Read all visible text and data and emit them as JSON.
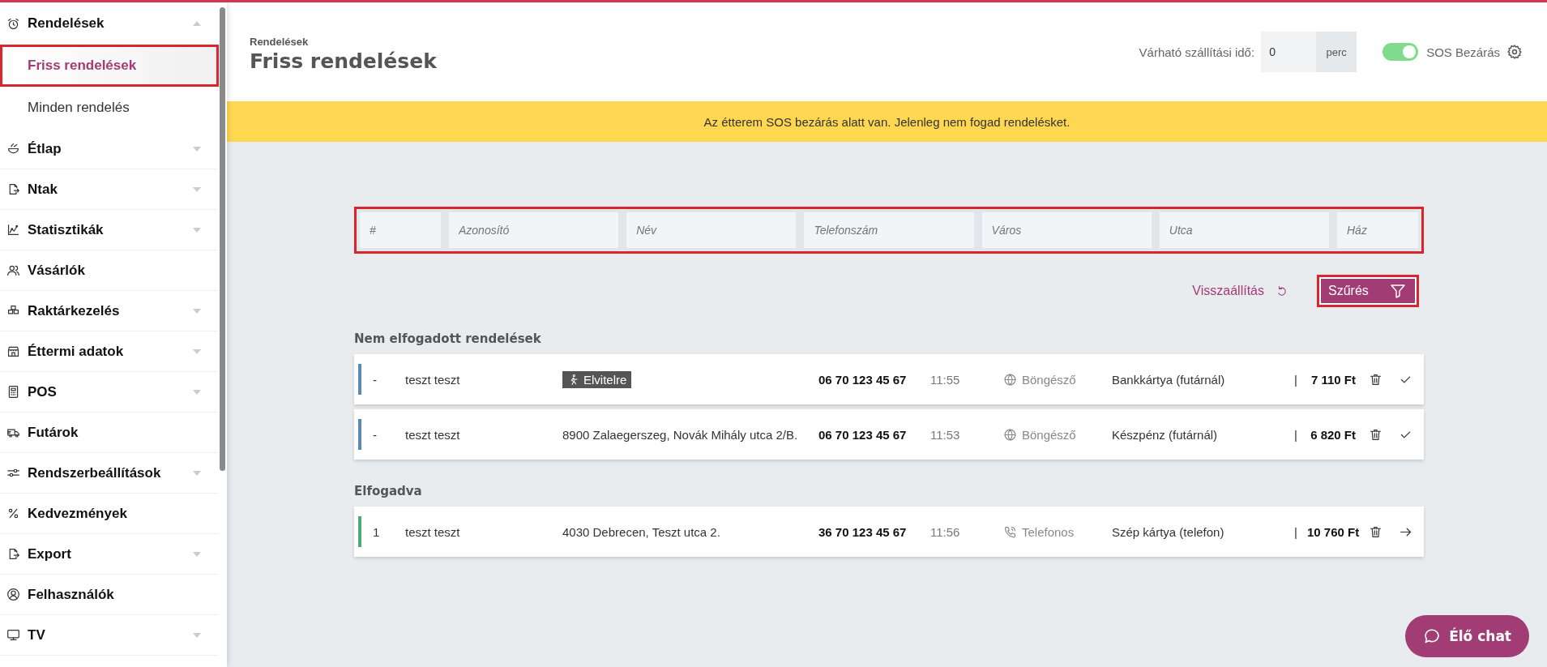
{
  "sidebar": {
    "items": [
      {
        "label": "Rendelések",
        "expandable": true,
        "expanded": true,
        "children": [
          {
            "label": "Friss rendelések",
            "selected": true,
            "highlighted": true
          },
          {
            "label": "Minden rendelés",
            "selected": false,
            "highlighted": false
          }
        ]
      },
      {
        "label": "Étlap",
        "expandable": true,
        "expanded": false
      },
      {
        "label": "Ntak",
        "expandable": true,
        "expanded": false
      },
      {
        "label": "Statisztikák",
        "expandable": true,
        "expanded": false
      },
      {
        "label": "Vásárlók",
        "expandable": false,
        "expanded": false
      },
      {
        "label": "Raktárkezelés",
        "expandable": true,
        "expanded": false
      },
      {
        "label": "Éttermi adatok",
        "expandable": true,
        "expanded": false
      },
      {
        "label": "POS",
        "expandable": true,
        "expanded": false
      },
      {
        "label": "Futárok",
        "expandable": false,
        "expanded": false
      },
      {
        "label": "Rendszerbeállítások",
        "expandable": true,
        "expanded": false
      },
      {
        "label": "Kedvezmények",
        "expandable": false,
        "expanded": false
      },
      {
        "label": "Export",
        "expandable": true,
        "expanded": false
      },
      {
        "label": "Felhasználók",
        "expandable": false,
        "expanded": false
      },
      {
        "label": "TV",
        "expandable": true,
        "expanded": false
      }
    ]
  },
  "header": {
    "breadcrumb": "Rendelések",
    "title": "Friss rendelések",
    "delivery_time": {
      "label": "Várható szállítási idő:",
      "value": "0",
      "unit": "perc"
    },
    "sos_toggle": {
      "label": "SOS Bezárás",
      "on": true
    }
  },
  "banner": "Az étterem SOS bezárás alatt van. Jelenleg nem fogad rendelésket.",
  "filter": {
    "highlighted": true,
    "fields": [
      {
        "placeholder": "#"
      },
      {
        "placeholder": "Azonosító"
      },
      {
        "placeholder": "Név"
      },
      {
        "placeholder": "Telefonszám"
      },
      {
        "placeholder": "Város"
      },
      {
        "placeholder": "Utca"
      },
      {
        "placeholder": "Ház"
      }
    ],
    "reset": "Visszaállítás",
    "submit": {
      "label": "Szűrés",
      "highlighted": true
    }
  },
  "sections": [
    {
      "title": "Nem elfogadott rendelések",
      "orders": [
        {
          "color": "#5b8bb5",
          "number": "-",
          "name": "teszt teszt",
          "destination": {
            "kind": "takeaway",
            "text": "Elvitelre"
          },
          "phone": "06 70 123 45 67",
          "time": "11:55",
          "source": {
            "kind": "web",
            "text": "Böngésző"
          },
          "payment": "Bankkártya (futárnál)",
          "separator": "|",
          "total": "7 110 Ft",
          "kind": "pending"
        },
        {
          "color": "#5b8bb5",
          "number": "-",
          "name": "teszt teszt",
          "destination": {
            "kind": "address",
            "text": "8900 Zalaegerszeg, Novák Mihály utca 2/B."
          },
          "phone": "06 70 123 45 67",
          "time": "11:53",
          "source": {
            "kind": "web",
            "text": "Böngésző"
          },
          "payment": "Készpénz (futárnál)",
          "separator": "|",
          "total": "6 820 Ft",
          "kind": "pending"
        }
      ]
    },
    {
      "title": "Elfogadva",
      "orders": [
        {
          "color": "#4daa72",
          "number": "1",
          "name": "teszt teszt",
          "destination": {
            "kind": "address",
            "text": "4030 Debrecen, Teszt utca 2."
          },
          "phone": "36 70 123 45 67",
          "time": "11:56",
          "source": {
            "kind": "phone",
            "text": "Telefonos"
          },
          "payment": "Szép kártya (telefon)",
          "separator": "|",
          "total": "10 760 Ft",
          "kind": "accepted"
        }
      ]
    }
  ],
  "chat_button": "Élő chat"
}
